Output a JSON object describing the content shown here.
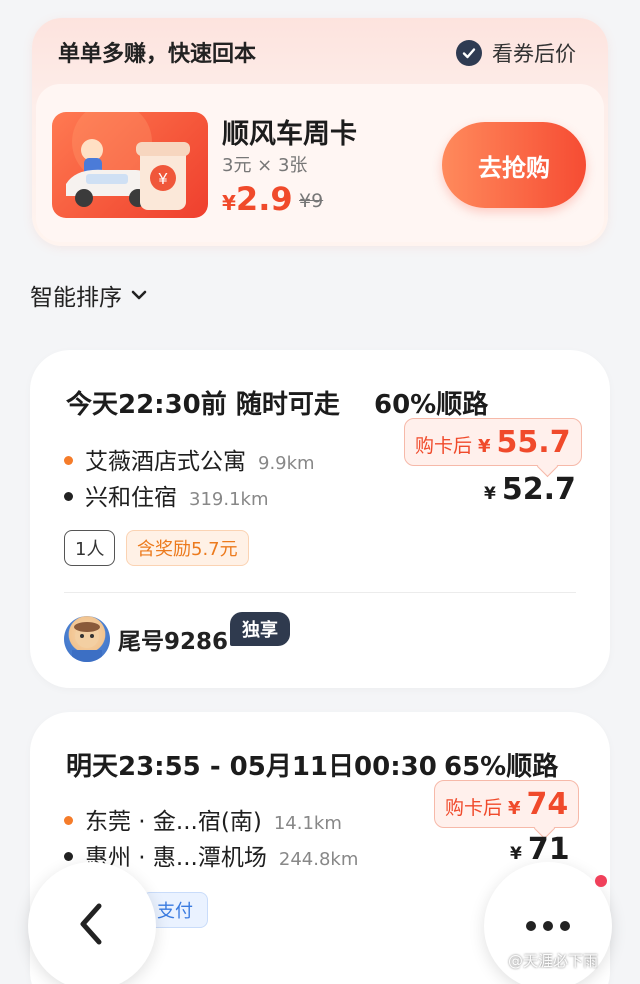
{
  "promo": {
    "title": "单单多赚，快速回本",
    "check_label": "看券后价",
    "product_name": "顺风车周卡",
    "product_sub": "3元 × 3张",
    "price_symbol": "¥",
    "price": "2.9",
    "old_price": "¥9",
    "buy_label": "去抢购"
  },
  "sort": {
    "label": "智能排序"
  },
  "orders": [
    {
      "time": "今天22:30前 随时可走",
      "match": "60%顺路",
      "from": {
        "name": "艾薇酒店式公寓",
        "dist": "9.9km"
      },
      "to": {
        "name": "兴和住宿",
        "dist": "319.1km"
      },
      "card_price_label": "购卡后",
      "card_price_symbol": "¥",
      "card_price": "55.7",
      "price_symbol": "¥",
      "price": "52.7",
      "tags": [
        "1人",
        "含奖励5.7元"
      ],
      "tail_label": "尾号9286",
      "exclusive": "独享"
    },
    {
      "time": "明天23:55 - 05月11日00:30",
      "match": "65%顺路",
      "from": {
        "name": "东莞 · 金...宿(南)",
        "dist": "14.1km"
      },
      "to": {
        "name": "惠州 · 惠...潭机场",
        "dist": "244.8km"
      },
      "card_price_label": "购卡后",
      "card_price_symbol": "¥",
      "card_price": "74",
      "price_symbol": "¥",
      "price": "71",
      "pay_tag": "支付"
    }
  ],
  "watermark": "@天涯必下雨",
  "colors": {
    "accent": "#f04a2b",
    "orange_dot": "#f57c2a",
    "dark": "#2f3a4e"
  },
  "icons": {
    "back": "chevron-left-icon",
    "more": "more-dots-icon",
    "check": "check-icon"
  }
}
